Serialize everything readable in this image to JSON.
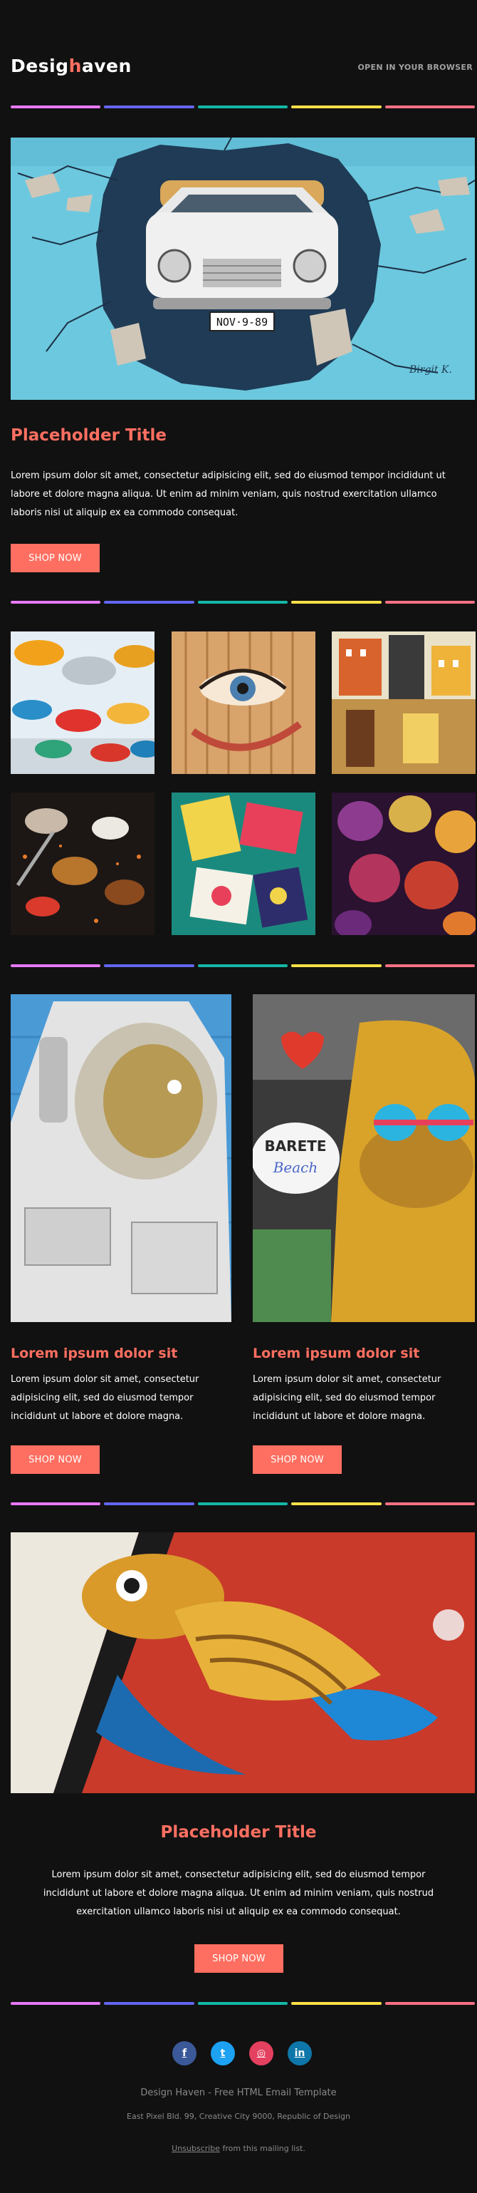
{
  "header": {
    "logo_prefix": "Desig",
    "logo_accent": "h",
    "logo_suffix": "aven",
    "browser_link": "OPEN IN YOUR BROWSER"
  },
  "hero": {
    "title": "Placeholder Title",
    "text": "Lorem ipsum dolor sit amet, consectetur adipisicing elit, sed do eiusmod tempor incididunt ut labore et dolore magna aliqua. Ut enim ad minim veniam, quis nostrud exercitation ullamco laboris nisi ut aliquip ex ea commodo consequat.",
    "button": "SHOP NOW",
    "plate_text": "NOV·9-89",
    "signature": "Birgit K."
  },
  "columns": [
    {
      "title": "Lorem ipsum dolor sit",
      "text": "Lorem ipsum dolor sit amet, consectetur adipisicing elit, sed do eiusmod tempor incididunt ut labore et dolore magna.",
      "button": "SHOP NOW"
    },
    {
      "title": "Lorem ipsum dolor sit",
      "text": "Lorem ipsum dolor sit amet, consectetur adipisicing elit, sed do eiusmod tempor incididunt ut labore et dolore magna.",
      "button": "SHOP NOW",
      "mural_text_1": "BARETE",
      "mural_text_2": "Beach"
    }
  ],
  "feature": {
    "title": "Placeholder Title",
    "text": "Lorem ipsum dolor sit amet, consectetur adipisicing elit, sed do eiusmod tempor incididunt ut labore et dolore magna aliqua. Ut enim ad minim veniam, quis nostrud exercitation ullamco laboris nisi ut aliquip ex ea commodo consequat.",
    "button": "SHOP NOW"
  },
  "footer": {
    "social": [
      {
        "name": "facebook",
        "glyph": "f"
      },
      {
        "name": "twitter",
        "glyph": "t"
      },
      {
        "name": "instagram",
        "glyph": "◎"
      },
      {
        "name": "linkedin",
        "glyph": "in"
      }
    ],
    "brand_line": "Design Haven - Free HTML Email Template",
    "address": "East Pixel Bld. 99, Creative City 9000, Republic of Design",
    "unsubscribe_link": "Unsubscribe",
    "unsubscribe_rest": " from this mailing list."
  },
  "colors": {
    "background": "#111111",
    "accent": "#ff6f61",
    "separator": [
      "#e879f9",
      "#6366f1",
      "#14b8a6",
      "#fde047",
      "#fb7185"
    ]
  }
}
